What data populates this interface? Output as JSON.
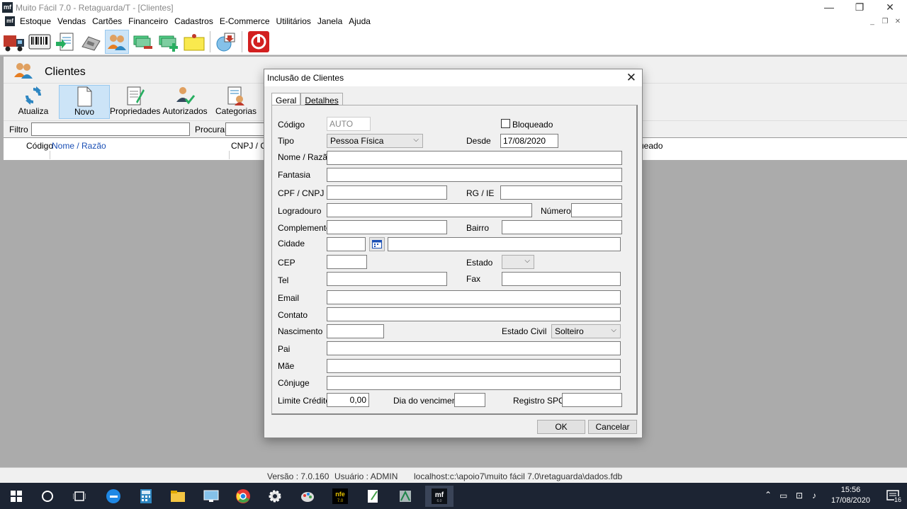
{
  "window": {
    "title": "Muito Fácil 7.0 - Retaguarda/T - [Clientes]",
    "logo_text": "mf"
  },
  "menu": [
    "Estoque",
    "Vendas",
    "Cartões",
    "Financeiro",
    "Cadastros",
    "E-Commerce",
    "Utilitários",
    "Janela",
    "Ajuda"
  ],
  "clientes": {
    "title": "Clientes",
    "toolbar": {
      "atualiza": "Atualiza",
      "novo": "Novo",
      "propriedades": "Propriedades",
      "autorizados": "Autorizados",
      "categorias": "Categorias"
    },
    "filter_label": "Filtro",
    "search_label": "Procurar",
    "columns": {
      "codigo": "Código",
      "nome": "Nome / Razão",
      "cnpj": "CNPJ / CP",
      "bloqueado": "ueado"
    }
  },
  "dialog": {
    "title": "Inclusão de Clientes",
    "tabs": [
      "Geral",
      "Detalhes"
    ],
    "labels": {
      "codigo": "Código",
      "bloqueado": "Bloqueado",
      "tipo": "Tipo",
      "desde": "Desde",
      "nome": "Nome / Razão",
      "fantasia": "Fantasia",
      "cpf": "CPF / CNPJ",
      "rg": "RG / IE",
      "logradouro": "Logradouro",
      "numero": "Número",
      "complemento": "Complemento",
      "bairro": "Bairro",
      "cidade": "Cidade",
      "cep": "CEP",
      "estado": "Estado",
      "tel": "Tel",
      "fax": "Fax",
      "email": "Email",
      "contato": "Contato",
      "nascimento": "Nascimento",
      "estado_civil": "Estado Civil",
      "pai": "Pai",
      "mae": "Mãe",
      "conjuge": "Cônjuge",
      "limite": "Limite Crédito",
      "vencimento": "Dia do vencimento",
      "spc": "Registro SPC"
    },
    "values": {
      "codigo": "AUTO",
      "tipo": "Pessoa Física",
      "desde": "17/08/2020",
      "estado_civil": "Solteiro",
      "limite": "0,00"
    },
    "buttons": {
      "ok": "OK",
      "cancel": "Cancelar"
    }
  },
  "status": {
    "versao": "Versão : 7.0.160",
    "usuario": "Usuário : ADMIN",
    "db": "localhost:c:\\apoio7\\muito fácil 7.0\\retaguarda\\dados.fdb"
  },
  "taskbar": {
    "time": "15:56",
    "date": "17/08/2020",
    "notifications": "16"
  }
}
